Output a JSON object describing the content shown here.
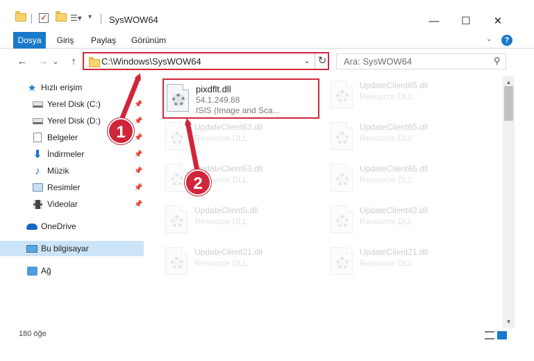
{
  "window": {
    "title": "SysWOW64",
    "controls": {
      "minimize": "—",
      "maximize": "☐",
      "close": "✕"
    }
  },
  "ribbon": {
    "tabs": [
      "Dosya",
      "Giriş",
      "Paylaş",
      "Görünüm"
    ],
    "help_icon": "?"
  },
  "nav": {
    "back_icon": "←",
    "forward_icon": "→",
    "recent_icon": "⌄",
    "up_icon": "↑",
    "address": "C:\\Windows\\SysWOW64",
    "dropdown_icon": "⌄",
    "refresh_icon": "↻",
    "search_placeholder": "Ara: SysWOW64",
    "search_icon": "⚲"
  },
  "sidebar": {
    "quick_access": "Hızlı erişim",
    "items": [
      {
        "label": "Yerel Disk (C:)",
        "icon": "drive-icon"
      },
      {
        "label": "Yerel Disk (D:)",
        "icon": "drive-icon"
      },
      {
        "label": "Belgeler",
        "icon": "documents-icon"
      },
      {
        "label": "İndirmeler",
        "icon": "downloads-icon"
      },
      {
        "label": "Müzik",
        "icon": "music-icon"
      },
      {
        "label": "Resimler",
        "icon": "pictures-icon"
      },
      {
        "label": "Videolar",
        "icon": "videos-icon"
      }
    ],
    "onedrive": "OneDrive",
    "this_pc": "Bu bilgisayar",
    "network": "Ağ"
  },
  "files": {
    "selected": {
      "name": "pixdflt.dll",
      "version": "54.1.249.88",
      "description": "ISIS (Image and Sca..."
    },
    "background": [
      {
        "name": "UpdateClient63.dll",
        "type": "Resource DLL"
      },
      {
        "name": "UpdateClient63.dll",
        "type": "Resource DLL"
      },
      {
        "name": "UpdateClient5.dll",
        "type": "Resource DLL"
      },
      {
        "name": "UpdateClient21.dll",
        "type": "Resource DLL"
      },
      {
        "name": "UpdateClient65.dll",
        "type": "Resource DLL"
      },
      {
        "name": "UpdateClient65.dll",
        "type": "Resource DLL"
      },
      {
        "name": "UpdateClient65.dll",
        "type": "Resource DLL"
      },
      {
        "name": "UpdateClient42.dll",
        "type": "Resource DLL"
      },
      {
        "name": "UpdateClient21.dll",
        "type": "Resource DLL"
      }
    ]
  },
  "status": {
    "count": "180 öğe"
  },
  "annotations": {
    "step1": "1",
    "step2": "2",
    "color": "#d0263a"
  }
}
